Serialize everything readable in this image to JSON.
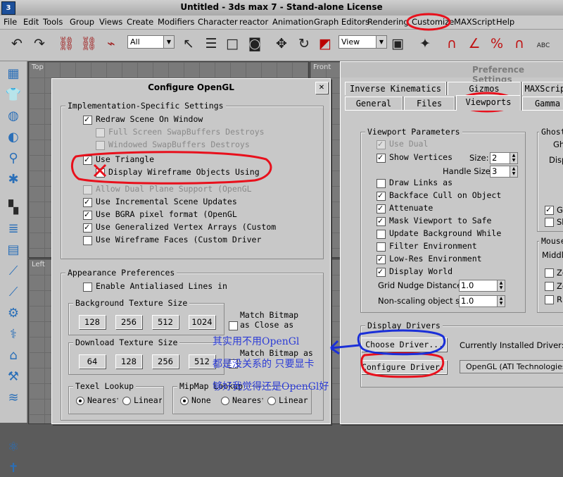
{
  "app": {
    "title": "Untitled - 3ds max 7 - Stand-alone License",
    "icon_text": "3"
  },
  "menu": [
    "File",
    "Edit",
    "Tools",
    "Group",
    "Views",
    "Create",
    "Modifiers",
    "Character",
    "reactor",
    "Animation",
    "Graph Editors",
    "Rendering",
    "Customize",
    "MAXScript",
    "Help"
  ],
  "toolbar": {
    "selection_filter": "All",
    "reference_coord": "View",
    "abc_label": "ABC"
  },
  "viewports": {
    "top": "Top",
    "left": "Left",
    "front": "Front"
  },
  "opengl": {
    "title": "Configure OpenGL",
    "impl_group": "Implementation-Specific Settings",
    "options": [
      {
        "label": "Redraw Scene On Window",
        "checked": true,
        "disabled": false
      },
      {
        "label": "Full Screen SwapBuffers Destroys",
        "checked": false,
        "disabled": true
      },
      {
        "label": "Windowed SwapBuffers Destroys",
        "checked": false,
        "disabled": true
      },
      {
        "label": "Use Triangle",
        "checked": true,
        "disabled": false
      },
      {
        "label": "Display Wireframe Objects Using",
        "checked": false,
        "disabled": false
      },
      {
        "label": "Allow Dual Plane Support (OpenGL",
        "checked": false,
        "disabled": true
      },
      {
        "label": "Use Incremental Scene Updates",
        "checked": true,
        "disabled": false
      },
      {
        "label": "Use BGRA pixel format (OpenGL",
        "checked": true,
        "disabled": false
      },
      {
        "label": "Use Generalized Vertex Arrays (Custom",
        "checked": true,
        "disabled": false
      },
      {
        "label": "Use Wireframe Faces (Custom Driver",
        "checked": false,
        "disabled": false
      }
    ],
    "appearance_group": "Appearance Preferences",
    "antialias_label": "Enable Antialiased Lines in",
    "bg_texture_group": "Background Texture Size",
    "bg_sizes": [
      "128",
      "256",
      "512",
      "1024"
    ],
    "match_bitmap": "Match Bitmap as",
    "match_bitmap_cut": "Close as",
    "dl_texture_group": "Download Texture Size",
    "dl_sizes": [
      "64",
      "128",
      "256",
      "512"
    ],
    "texel_group": "Texel Lookup",
    "texel_options": [
      "Nearest",
      "Linear"
    ],
    "mipmap_group": "MipMap Lookup",
    "mipmap_options": [
      "None",
      "Nearest",
      "Linear"
    ]
  },
  "prefs": {
    "title": "Preference Settings",
    "tabs_top": [
      "Inverse Kinematics",
      "Gizmos",
      "MAXScript"
    ],
    "tabs_bottom": [
      "General",
      "Files",
      "Viewports",
      "Gamma"
    ],
    "vp_params_group": "Viewport Parameters",
    "vp_options": [
      {
        "label": "Use Dual",
        "checked": true,
        "disabled": true
      },
      {
        "label": "Show Vertices",
        "checked": true,
        "disabled": false
      },
      {
        "label": "Draw Links as",
        "checked": false,
        "disabled": false
      },
      {
        "label": "Backface Cull on Object",
        "checked": true,
        "disabled": false
      },
      {
        "label": "Attenuate",
        "checked": true,
        "disabled": false
      },
      {
        "label": "Mask Viewport to Safe",
        "checked": true,
        "disabled": false
      },
      {
        "label": "Update Background While",
        "checked": false,
        "disabled": false
      },
      {
        "label": "Filter Environment",
        "checked": false,
        "disabled": false
      },
      {
        "label": "Low-Res Environment",
        "checked": true,
        "disabled": false
      },
      {
        "label": "Display World",
        "checked": true,
        "disabled": false
      }
    ],
    "size_label": "Size:",
    "size_value": "2",
    "handle_size_label": "Handle Size:",
    "handle_size_value": "3",
    "grid_nudge_label": "Grid Nudge Distance:",
    "grid_nudge_value": "1.0",
    "nonscaling_label": "Non-scaling object size:",
    "nonscaling_value": "1.0",
    "ghost_group": "Ghost",
    "ghost_gh": "Gh",
    "ghost_disp": "Disp",
    "ghost_cb1": "Gh",
    "ghost_cb2": "Sh",
    "mouse_group": "Mouse",
    "mouse_middle": "Middle",
    "mouse_z1": "Zo",
    "mouse_z2": "Zo",
    "mouse_r": "Ri",
    "drivers_group": "Display Drivers",
    "choose_driver": "Choose Driver...",
    "configure_driver": "Configure Driver...",
    "installed_label": "Currently Installed Driver:",
    "installed_value": "OpenGL (ATI Technologies In"
  },
  "annotation": {
    "line1": "其实用不用OpenGl",
    "line2": "都是没关系的  只要显卡",
    "line3": "够好我觉得还是OpenGl好"
  },
  "colors": {
    "annotation_red": "#e8101c",
    "annotation_blue": "#1a2fd8"
  }
}
